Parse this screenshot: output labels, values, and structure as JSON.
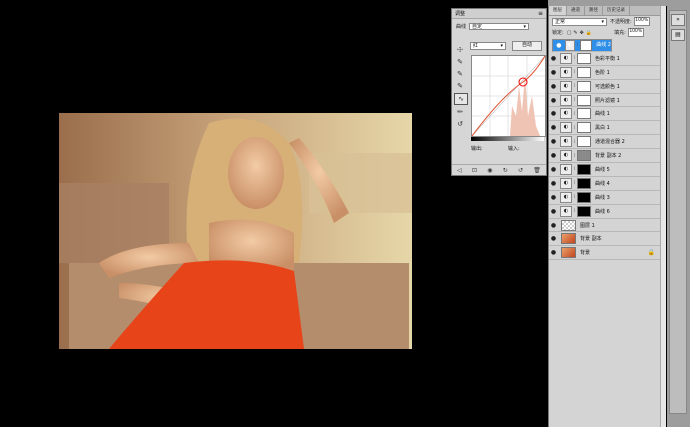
{
  "adjustments_panel": {
    "title": "调整",
    "preset_label": "曲线",
    "preset_value": "自定",
    "channel_value": "红",
    "auto_button": "自动",
    "output_label": "输出:",
    "input_label": "输入:",
    "tools": [
      "curve-target-icon",
      "eyedropper-black-icon",
      "eyedropper-gray-icon",
      "eyedropper-white-icon",
      "curve-point-icon",
      "pencil-icon",
      "smooth-icon"
    ]
  },
  "layers_panel": {
    "tabs": [
      "图层",
      "通道",
      "路径",
      "历史记录"
    ],
    "blend_mode": "正常",
    "opacity_label": "不透明度:",
    "opacity_value": "100%",
    "lock_label": "锁定:",
    "fill_label": "填充:",
    "fill_value": "100%",
    "layers": [
      {
        "name": "曲线 2",
        "mask": "white",
        "selected": true
      },
      {
        "name": "色彩平衡 1",
        "mask": "white",
        "selected": false
      },
      {
        "name": "色阶 1",
        "mask": "white",
        "selected": false
      },
      {
        "name": "可选颜色 1",
        "mask": "white",
        "selected": false
      },
      {
        "name": "照片滤镜 1",
        "mask": "white",
        "selected": false
      },
      {
        "name": "曲线 1",
        "mask": "white",
        "selected": false
      },
      {
        "name": "黑白 1",
        "mask": "white",
        "selected": false
      },
      {
        "name": "通道混合器 2",
        "mask": "white",
        "selected": false
      },
      {
        "name": "背景 副本 2",
        "mask": "gray",
        "selected": false
      },
      {
        "name": "曲线 5",
        "mask": "black",
        "selected": false
      },
      {
        "name": "曲线 4",
        "mask": "black",
        "selected": false
      },
      {
        "name": "曲线 3",
        "mask": "black",
        "selected": false
      },
      {
        "name": "曲线 6",
        "mask": "black",
        "selected": false
      },
      {
        "name": "图层 1",
        "mask": "checker",
        "selected": false
      },
      {
        "name": "背景 副本",
        "mask": "photo",
        "selected": false
      },
      {
        "name": "背景",
        "mask": "photo",
        "selected": false,
        "locked": true
      }
    ]
  },
  "colors": {
    "background": "#000000",
    "dress": "#e8441a",
    "selection": "#2f8ee7",
    "curve": "#e05030"
  }
}
